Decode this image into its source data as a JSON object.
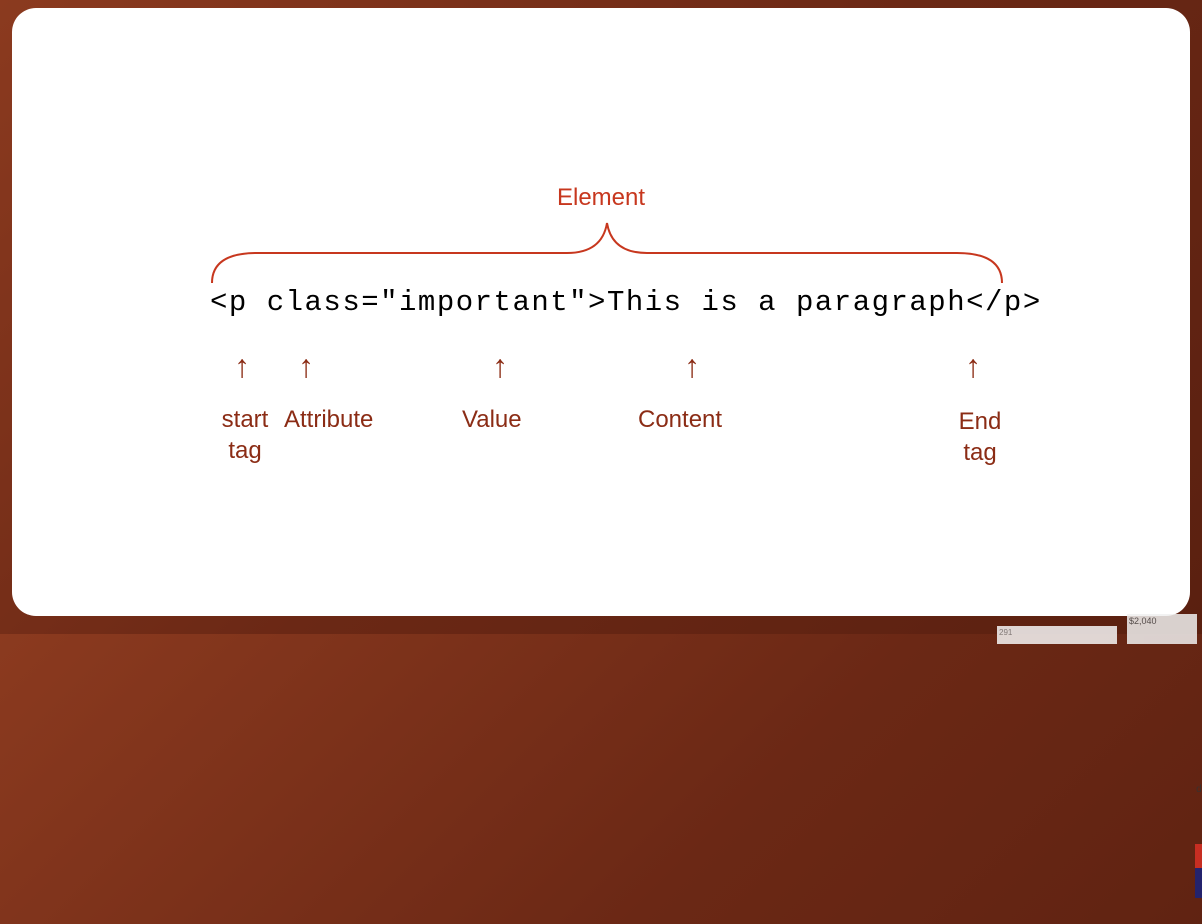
{
  "diagram": {
    "title": "Element",
    "code": "<p class=\"important\">This is a paragraph</p>",
    "annotations": {
      "start_tag": "start tag",
      "attribute": "Attribute",
      "value": "Value",
      "content": "Content",
      "end_tag": "End tag"
    },
    "arrow_glyph": "↑"
  },
  "background": {
    "price_text": "$2,040",
    "number_text": "291",
    "small_label": "d)"
  }
}
